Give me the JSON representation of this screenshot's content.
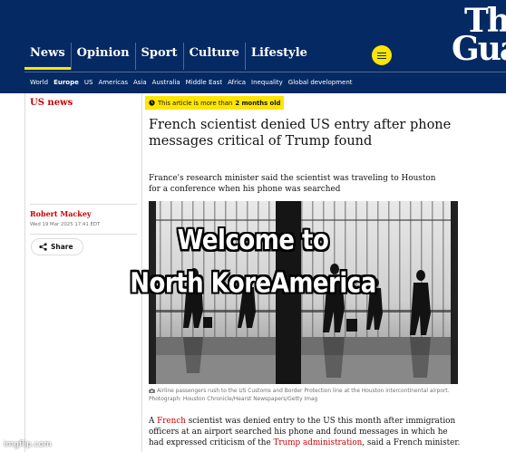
{
  "header": {
    "pillars": [
      {
        "label": "News",
        "active": true
      },
      {
        "label": "Opinion",
        "active": false
      },
      {
        "label": "Sport",
        "active": false
      },
      {
        "label": "Culture",
        "active": false
      },
      {
        "label": "Lifestyle",
        "active": false
      }
    ],
    "menu_icon": "hamburger-menu-icon",
    "logo_lines": [
      "Th",
      "Gua"
    ],
    "subnav": [
      {
        "label": "World",
        "active": false
      },
      {
        "label": "Europe",
        "active": true
      },
      {
        "label": "US",
        "active": false
      },
      {
        "label": "Americas",
        "active": false
      },
      {
        "label": "Asia",
        "active": false
      },
      {
        "label": "Australia",
        "active": false
      },
      {
        "label": "Middle East",
        "active": false
      },
      {
        "label": "Africa",
        "active": false
      },
      {
        "label": "Inequality",
        "active": false
      },
      {
        "label": "Global development",
        "active": false
      }
    ]
  },
  "article": {
    "section": "US news",
    "age_warning": {
      "icon": "clock-icon",
      "prefix": "This article is more than",
      "emphasis": "2 months old"
    },
    "headline": "French scientist denied US entry after phone messages critical of Trump found",
    "standfirst": "France's research minister said the scientist was traveling to Houston for a conference when his phone was searched",
    "byline": "Robert Mackey",
    "dateline": "Wed 19 Mar 2025 17.41 EDT",
    "share": {
      "label": "Share",
      "icon": "share-icon"
    },
    "caption": {
      "icon": "camera-icon",
      "text": "Airline passengers rush to the US Customs and Border Protection line at the Houston intercontinental airport. Photograph: Houston Chronicle/Hearst Newspapers/Getty Imag"
    },
    "body": {
      "t1": "A ",
      "link1": "French",
      "t2": " scientist was denied entry to the US this month after immigration officers at an airport searched his phone and found messages in which he had expressed criticism of the ",
      "link2": "Trump administration",
      "t3": ", said a French minister."
    }
  },
  "meme": {
    "lines": [
      "Welcome to",
      "North KoreAmerica"
    ]
  },
  "watermark": "imgflip.com",
  "colors": {
    "brand_navy": "#052962",
    "accent_yellow": "#ffe500",
    "news_red": "#c70000",
    "text": "#121212",
    "muted": "#707070"
  }
}
